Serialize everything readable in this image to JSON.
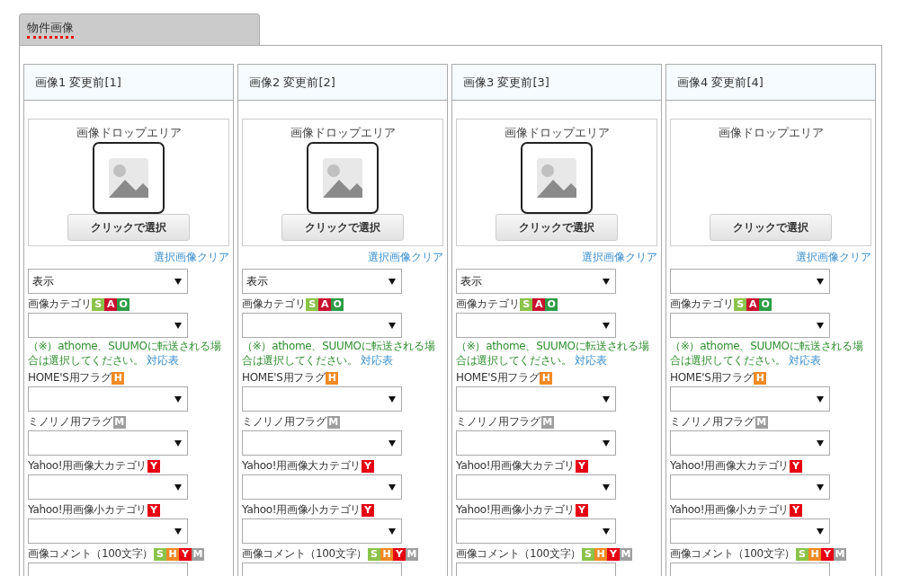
{
  "tab": {
    "label": "物件画像",
    "selected": true
  },
  "columns": [
    {
      "title": "画像1 変更前[1]",
      "drop_label": "画像ドロップエリア",
      "select_button": "クリックで選択",
      "clear_link": "選択画像クリア",
      "display_select": {
        "value": "表示"
      },
      "fields": [
        {
          "kind": "select",
          "label": "画像カテゴリ",
          "badges": [
            {
              "letter": "S",
              "color": "#8bc34a"
            },
            {
              "letter": "A",
              "color": "#c8102e"
            },
            {
              "letter": "O",
              "color": "#2e9c47"
            }
          ],
          "note": "（※）athome、SUUMOに転送される場合は選択してください。",
          "note_link": "対応表"
        },
        {
          "kind": "select",
          "label": "HOME'S用フラグ",
          "badges": [
            {
              "letter": "H",
              "color": "#f08a24"
            }
          ]
        },
        {
          "kind": "select",
          "label": "ミノリノ用フラグ",
          "badges": [
            {
              "letter": "M",
              "color": "#9e9e9e"
            }
          ]
        },
        {
          "kind": "select",
          "label": "Yahoo!用画像大カテゴリ",
          "badges": [
            {
              "letter": "Y",
              "color": "#e60012"
            }
          ]
        },
        {
          "kind": "select",
          "label": "Yahoo!用画像小カテゴリ",
          "badges": [
            {
              "letter": "Y",
              "color": "#e60012"
            }
          ]
        },
        {
          "kind": "text",
          "label": "画像コメント（100文字）",
          "badges": [
            {
              "letter": "S",
              "color": "#8bc34a"
            },
            {
              "letter": "H",
              "color": "#f08a24"
            },
            {
              "letter": "Y",
              "color": "#e60012"
            },
            {
              "letter": "M",
              "color": "#9e9e9e"
            }
          ]
        }
      ]
    },
    {
      "title": "画像2 変更前[2]",
      "drop_label": "画像ドロップエリア",
      "select_button": "クリックで選択",
      "clear_link": "選択画像クリア",
      "display_select": {
        "value": "表示"
      },
      "fields": [
        {
          "kind": "select",
          "label": "画像カテゴリ",
          "badges": [
            {
              "letter": "S",
              "color": "#8bc34a"
            },
            {
              "letter": "A",
              "color": "#c8102e"
            },
            {
              "letter": "O",
              "color": "#2e9c47"
            }
          ],
          "note": "（※）athome、SUUMOに転送される場合は選択してください。",
          "note_link": "対応表"
        },
        {
          "kind": "select",
          "label": "HOME'S用フラグ",
          "badges": [
            {
              "letter": "H",
              "color": "#f08a24"
            }
          ]
        },
        {
          "kind": "select",
          "label": "ミノリノ用フラグ",
          "badges": [
            {
              "letter": "M",
              "color": "#9e9e9e"
            }
          ]
        },
        {
          "kind": "select",
          "label": "Yahoo!用画像大カテゴリ",
          "badges": [
            {
              "letter": "Y",
              "color": "#e60012"
            }
          ]
        },
        {
          "kind": "select",
          "label": "Yahoo!用画像小カテゴリ",
          "badges": [
            {
              "letter": "Y",
              "color": "#e60012"
            }
          ]
        },
        {
          "kind": "text",
          "label": "画像コメント（100文字）",
          "badges": [
            {
              "letter": "S",
              "color": "#8bc34a"
            },
            {
              "letter": "H",
              "color": "#f08a24"
            },
            {
              "letter": "Y",
              "color": "#e60012"
            },
            {
              "letter": "M",
              "color": "#9e9e9e"
            }
          ]
        }
      ]
    },
    {
      "title": "画像3 変更前[3]",
      "drop_label": "画像ドロップエリア",
      "select_button": "クリックで選択",
      "clear_link": "選択画像クリア",
      "display_select": {
        "value": "表示"
      },
      "fields": [
        {
          "kind": "select",
          "label": "画像カテゴリ",
          "badges": [
            {
              "letter": "S",
              "color": "#8bc34a"
            },
            {
              "letter": "A",
              "color": "#c8102e"
            },
            {
              "letter": "O",
              "color": "#2e9c47"
            }
          ],
          "note": "（※）athome、SUUMOに転送される場合は選択してください。",
          "note_link": "対応表"
        },
        {
          "kind": "select",
          "label": "HOME'S用フラグ",
          "badges": [
            {
              "letter": "H",
              "color": "#f08a24"
            }
          ]
        },
        {
          "kind": "select",
          "label": "ミノリノ用フラグ",
          "badges": [
            {
              "letter": "M",
              "color": "#9e9e9e"
            }
          ]
        },
        {
          "kind": "select",
          "label": "Yahoo!用画像大カテゴリ",
          "badges": [
            {
              "letter": "Y",
              "color": "#e60012"
            }
          ]
        },
        {
          "kind": "select",
          "label": "Yahoo!用画像小カテゴリ",
          "badges": [
            {
              "letter": "Y",
              "color": "#e60012"
            }
          ]
        },
        {
          "kind": "text",
          "label": "画像コメント（100文字）",
          "badges": [
            {
              "letter": "S",
              "color": "#8bc34a"
            },
            {
              "letter": "H",
              "color": "#f08a24"
            },
            {
              "letter": "Y",
              "color": "#e60012"
            },
            {
              "letter": "M",
              "color": "#9e9e9e"
            }
          ]
        }
      ]
    },
    {
      "title": "画像4 変更前[4]",
      "drop_label": "画像ドロップエリア",
      "select_button": "クリックで選択",
      "clear_link": "選択画像クリア",
      "fields": [
        {
          "kind": "select",
          "label": "画像カテゴリ",
          "badges": [
            {
              "letter": "S",
              "color": "#8bc34a"
            },
            {
              "letter": "A",
              "color": "#c8102e"
            },
            {
              "letter": "O",
              "color": "#2e9c47"
            }
          ],
          "note": "（※）athome、SUUMOに転送される場合は選択してください。",
          "note_link": "対応表"
        },
        {
          "kind": "select",
          "label": "HOME'S用フラグ",
          "badges": [
            {
              "letter": "H",
              "color": "#f08a24"
            }
          ]
        },
        {
          "kind": "select",
          "label": "ミノリノ用フラグ",
          "badges": [
            {
              "letter": "M",
              "color": "#9e9e9e"
            }
          ]
        },
        {
          "kind": "select",
          "label": "Yahoo!用画像大カテゴリ",
          "badges": [
            {
              "letter": "Y",
              "color": "#e60012"
            }
          ]
        },
        {
          "kind": "select",
          "label": "Yahoo!用画像小カテゴリ",
          "badges": [
            {
              "letter": "Y",
              "color": "#e60012"
            }
          ]
        },
        {
          "kind": "text",
          "label": "画像コメント（100文字）",
          "badges": [
            {
              "letter": "S",
              "color": "#8bc34a"
            },
            {
              "letter": "H",
              "color": "#f08a24"
            },
            {
              "letter": "Y",
              "color": "#e60012"
            },
            {
              "letter": "M",
              "color": "#9e9e9e"
            }
          ]
        }
      ]
    }
  ]
}
